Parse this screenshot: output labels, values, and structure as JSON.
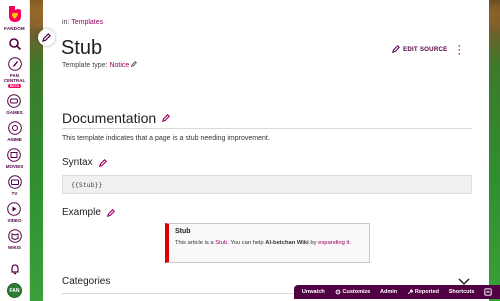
{
  "nav": {
    "brand": "FANDOM",
    "items": [
      {
        "label": "FAN\nCENTRAL",
        "badge": "BETA"
      },
      {
        "label": "GAMES"
      },
      {
        "label": "ANIME"
      },
      {
        "label": "MOVIES"
      },
      {
        "label": "TV"
      },
      {
        "label": "VIDEO"
      },
      {
        "label": "WIKIS"
      }
    ],
    "avatar_text": "FAN"
  },
  "breadcrumb": {
    "prefix": "in:",
    "link": "Templates"
  },
  "page": {
    "title": "Stub",
    "template_type_label": "Template type:",
    "template_type_value": "Notice",
    "edit_source": "EDIT SOURCE"
  },
  "sections": {
    "documentation": "Documentation",
    "description": "This template indicates that a page is a stub needing improvement.",
    "syntax": "Syntax",
    "code": "{{Stub}}",
    "example": "Example",
    "categories": "Categories"
  },
  "ambox": {
    "title": "Stub",
    "text_before": "This article is a",
    "link1": "Stub",
    "text_mid": ". You can help",
    "wiki_name": "AI-betchan Wiki",
    "text_by": "by",
    "link2": "expanding it",
    "text_end": "."
  },
  "toolbar": {
    "unwatch": "Unwatch",
    "customize": "Customize",
    "admin": "Admin",
    "reported": "Reported",
    "shortcuts": "Shortcuts"
  },
  "colors": {
    "brand": "#520044",
    "link": "#9a0063",
    "accent": "#fa005a",
    "ambox_border": "#dd0000"
  }
}
